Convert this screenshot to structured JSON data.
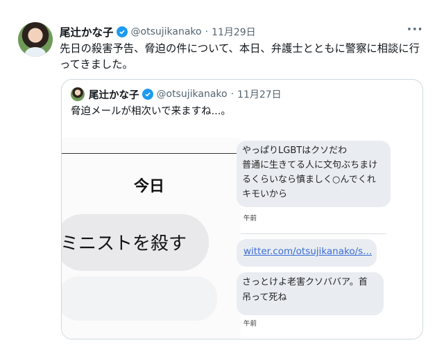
{
  "tweet": {
    "author_name": "尾辻かな子",
    "handle": "@otsujikanako",
    "separator": "·",
    "date": "11月29日",
    "more": "···",
    "text": "先日の殺害予告、脅迫の件について、本日、弁護士とともに警察に相談に行ってきました。"
  },
  "quoted_tweet": {
    "author_name": "尾辻かな子",
    "handle": "@otsujikanako",
    "separator": "·",
    "date": "11月27日",
    "text": "脅迫メールが相次いで来ますね...。"
  },
  "screenshot_left": {
    "day_label": "今日",
    "message": "ミニストを殺す"
  },
  "screenshot_right": {
    "message1_lines": [
      "やっぱりLGBTはクソだわ",
      "普通に生きてる人に文句ぶちまけ",
      "るくらいなら慎ましく○んでくれ",
      "キモいから"
    ],
    "time1": "午前",
    "link": "witter.com/otsujikanako/s...",
    "message2_lines": [
      "さっとけよ老害クソババア。首",
      "吊って死ね"
    ],
    "time2": "午前"
  },
  "colors": {
    "verified_badge": "#1d9bf0",
    "link": "#3a6bd6",
    "secondary_text": "#536471"
  }
}
